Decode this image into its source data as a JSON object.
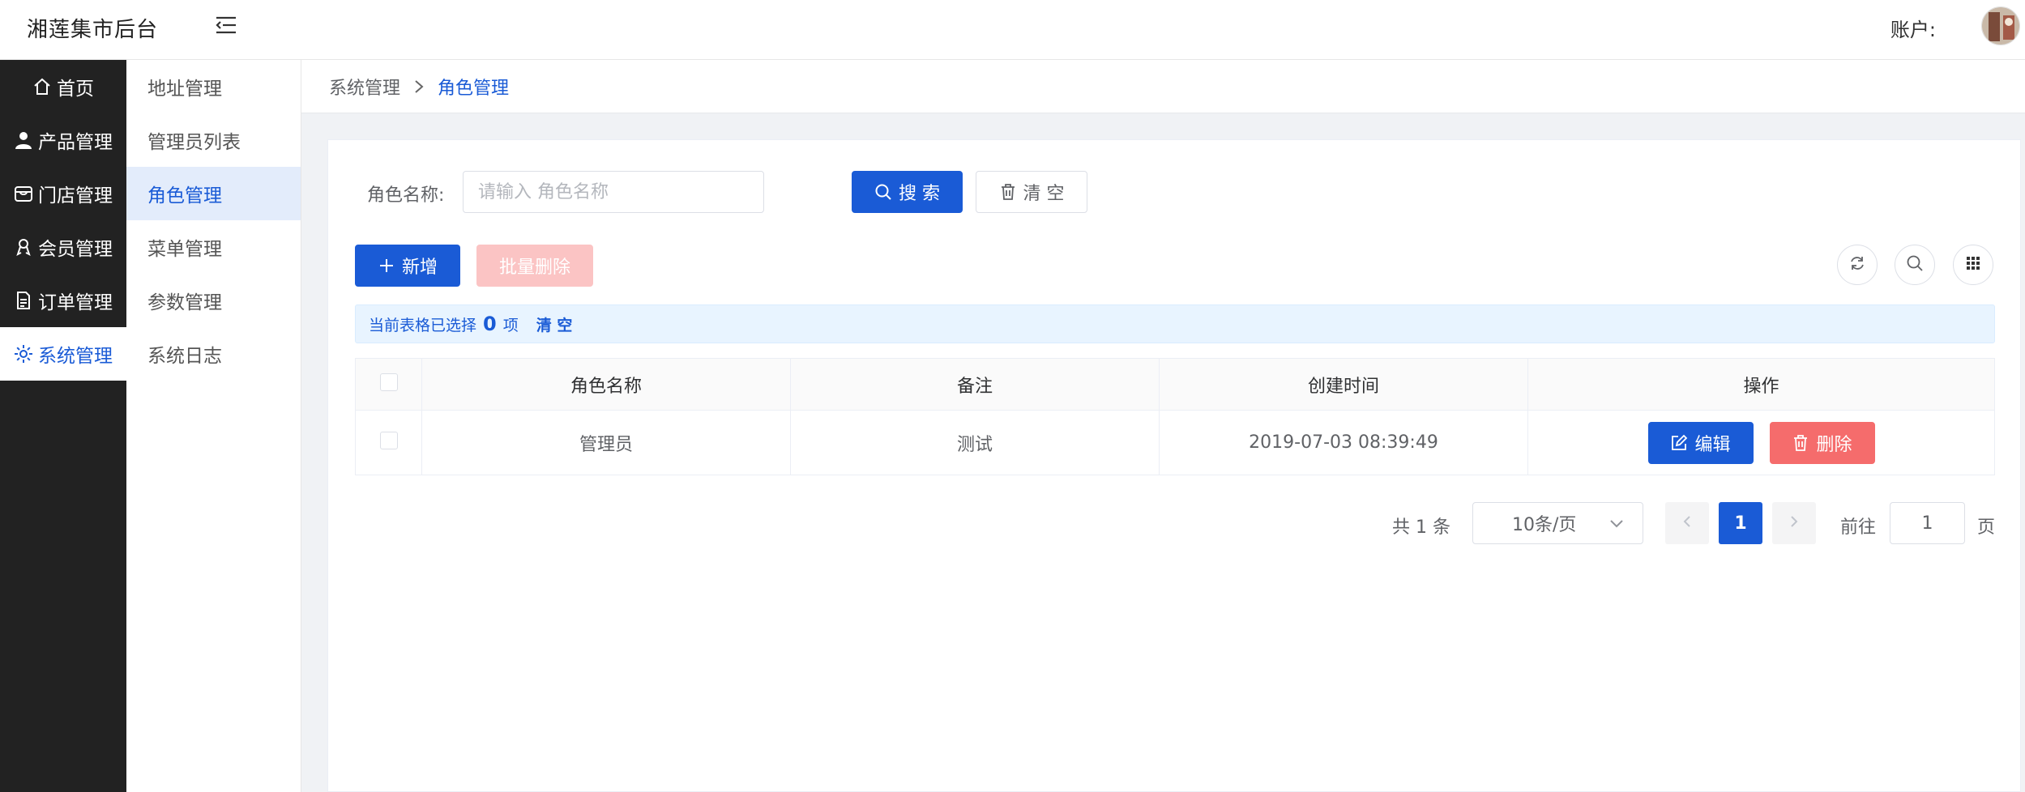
{
  "app": {
    "title": "湘莲集市后台",
    "account_label": "账户:"
  },
  "sidebar": {
    "items": [
      {
        "label": "首页",
        "icon": "home-icon"
      },
      {
        "label": "产品管理",
        "icon": "user-icon"
      },
      {
        "label": "门店管理",
        "icon": "store-icon"
      },
      {
        "label": "会员管理",
        "icon": "member-icon"
      },
      {
        "label": "订单管理",
        "icon": "document-icon"
      },
      {
        "label": "系统管理",
        "icon": "gear-icon",
        "active": true
      }
    ]
  },
  "submenu": {
    "items": [
      {
        "label": "地址管理"
      },
      {
        "label": "管理员列表"
      },
      {
        "label": "角色管理",
        "active": true
      },
      {
        "label": "菜单管理"
      },
      {
        "label": "参数管理"
      },
      {
        "label": "系统日志"
      }
    ]
  },
  "breadcrumb": {
    "parent": "系统管理",
    "current": "角色管理"
  },
  "search": {
    "label": "角色名称:",
    "placeholder": "请输入 角色名称",
    "value": "",
    "search_button": "搜 索",
    "clear_button": "清 空"
  },
  "toolbar": {
    "add_button": "新增",
    "batch_delete_button": "批量删除"
  },
  "selection": {
    "prefix": "当前表格已选择",
    "count": "0",
    "suffix": "项",
    "clear": "清 空"
  },
  "table": {
    "headers": {
      "name": "角色名称",
      "note": "备注",
      "time": "创建时间",
      "ops": "操作"
    },
    "rows": [
      {
        "name": "管理员",
        "note": "测试",
        "time": "2019-07-03 08:39:49",
        "edit": "编辑",
        "delete": "删除"
      }
    ]
  },
  "pagination": {
    "total": "共 1 条",
    "page_size": "10条/页",
    "current_page": "1",
    "goto_label": "前往",
    "goto_value": "1",
    "page_label": "页"
  },
  "colors": {
    "primary": "#1a5bd6",
    "sidebar_bg": "#222222",
    "danger": "#f56c6c",
    "danger_disabled": "#fbc4c4"
  }
}
